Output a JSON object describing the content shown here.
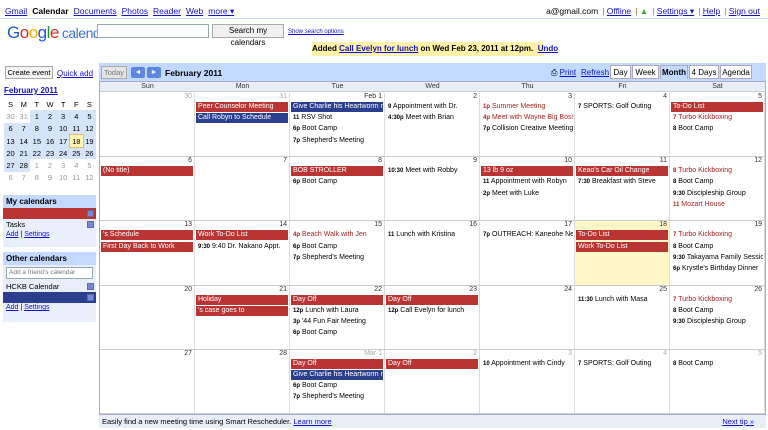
{
  "topbar": {
    "nav": [
      "Gmail",
      "Calendar",
      "Documents",
      "Photos",
      "Reader",
      "Web",
      "more ▾"
    ],
    "account": "a@gmail.com",
    "links": [
      "Offline",
      "Settings ▾",
      "Help",
      "Sign out"
    ]
  },
  "logo": {
    "google": [
      "G",
      "o",
      "o",
      "g",
      "l",
      "e"
    ],
    "product": "calendar"
  },
  "search": {
    "button": "Search my calendars",
    "options": "Show search options"
  },
  "notice": {
    "prefix": "Added ",
    "event": "Call Evelyn for lunch",
    "when": " on Wed Feb 23, 2011 at 12pm.",
    "undo": "Undo"
  },
  "sidebar": {
    "create_label": "Create event",
    "quick_add": "Quick add",
    "mini_title": "February 2011",
    "mini_dow": [
      "S",
      "M",
      "T",
      "W",
      "T",
      "F",
      "S"
    ],
    "mini_weeks": [
      [
        "30",
        "31",
        "1",
        "2",
        "3",
        "4",
        "5"
      ],
      [
        "6",
        "7",
        "8",
        "9",
        "10",
        "11",
        "12"
      ],
      [
        "13",
        "14",
        "15",
        "16",
        "17",
        "18",
        "19"
      ],
      [
        "20",
        "21",
        "22",
        "23",
        "24",
        "25",
        "26"
      ],
      [
        "27",
        "28",
        "1",
        "2",
        "3",
        "4",
        "5"
      ],
      [
        "6",
        "7",
        "8",
        "9",
        "10",
        "11",
        "12"
      ]
    ],
    "my_cal_title": "My calendars",
    "my_cals": [
      "",
      "Tasks"
    ],
    "my_links": [
      "Add",
      "Settings"
    ],
    "other_cal_title": "Other calendars",
    "friend_placeholder": "Add a friend's calendar",
    "other_cals": [
      "HCKB Calendar",
      ""
    ],
    "other_links": [
      "Add",
      "Settings"
    ]
  },
  "toolbar": {
    "today": "Today",
    "prev": "◄",
    "next": "►",
    "title": "February 2011",
    "print": "Print",
    "refresh": "Refresh",
    "views": [
      "Day",
      "Week",
      "Month",
      "4 Days",
      "Agenda"
    ],
    "active_view": "Month"
  },
  "dow": [
    "Sun",
    "Mon",
    "Tue",
    "Wed",
    "Thu",
    "Fri",
    "Sat"
  ],
  "weeks": [
    {
      "days": [
        "30",
        "31",
        "Feb 1",
        "2",
        "3",
        "4",
        "5"
      ],
      "dim": [
        0,
        1
      ],
      "events": [
        {
          "col": 1,
          "row": 0,
          "type": "red",
          "text": "Peer Counselor Meeting"
        },
        {
          "col": 1,
          "row": 1,
          "type": "blue",
          "text": "Call Robyn            to Schedule"
        },
        {
          "col": 2,
          "row": 0,
          "type": "blue",
          "text": "Give Charlie his Heartworm m"
        },
        {
          "col": 2,
          "row": 1,
          "type": "txt",
          "time": "11",
          "text": "RSV Shot"
        },
        {
          "col": 2,
          "row": 2,
          "type": "txt",
          "time": "6p",
          "text": "Boot Camp"
        },
        {
          "col": 2,
          "row": 3,
          "type": "txt",
          "time": "7p",
          "text": "Shepherd's Meeting"
        },
        {
          "col": 3,
          "row": 0,
          "type": "txt",
          "time": "9",
          "text": "Appointment with Dr."
        },
        {
          "col": 3,
          "row": 1,
          "type": "txt",
          "time": "4:30p",
          "text": "Meet with Brian"
        },
        {
          "col": 4,
          "row": 0,
          "type": "txt",
          "rc": 1,
          "time": "1p",
          "text": "Summer Meeting"
        },
        {
          "col": 4,
          "row": 1,
          "type": "txt",
          "rc": 1,
          "time": "4p",
          "text": "Meet with Wayne Big Boss"
        },
        {
          "col": 4,
          "row": 2,
          "type": "txt",
          "time": "7p",
          "text": "Collision Creative Meeting"
        },
        {
          "col": 5,
          "row": 0,
          "type": "txt",
          "time": "7",
          "text": "SPORTS: Golf Outing"
        },
        {
          "col": 6,
          "row": 0,
          "type": "red",
          "text": "To-Do List"
        },
        {
          "col": 6,
          "row": 1,
          "type": "txt",
          "rc": 1,
          "time": "7",
          "text": "Turbo Kickboxing"
        },
        {
          "col": 6,
          "row": 2,
          "type": "txt",
          "time": "8",
          "text": "Boot Camp"
        }
      ]
    },
    {
      "days": [
        "6",
        "7",
        "8",
        "9",
        "10",
        "11",
        "12"
      ],
      "dim": [],
      "events": [
        {
          "col": 0,
          "row": 0,
          "type": "red",
          "text": "(No title)"
        },
        {
          "col": 2,
          "row": 0,
          "type": "red",
          "text": "BOB STROLLER"
        },
        {
          "col": 2,
          "row": 1,
          "type": "txt",
          "time": "6p",
          "text": "Boot Camp"
        },
        {
          "col": 3,
          "row": 0,
          "type": "txt",
          "time": "10:30",
          "text": "Meet with Robby"
        },
        {
          "col": 4,
          "row": 0,
          "type": "red",
          "text": "13 lb 9 oz"
        },
        {
          "col": 4,
          "row": 1,
          "type": "txt",
          "time": "11",
          "text": "Appointment with Robyn"
        },
        {
          "col": 4,
          "row": 2,
          "type": "txt",
          "time": "2p",
          "text": "Meet with Luke"
        },
        {
          "col": 5,
          "row": 0,
          "type": "red",
          "text": "Keao's Car Oil Change"
        },
        {
          "col": 5,
          "row": 1,
          "type": "txt",
          "time": "7:30",
          "text": "Breakfast with Steve"
        },
        {
          "col": 6,
          "row": 0,
          "type": "txt",
          "rc": 1,
          "time": "8",
          "text": "Turbo Kickboxing"
        },
        {
          "col": 6,
          "row": 1,
          "type": "txt",
          "time": "8",
          "text": "Boot Camp"
        },
        {
          "col": 6,
          "row": 2,
          "type": "txt",
          "time": "9:30",
          "text": "Discipleship Group"
        },
        {
          "col": 6,
          "row": 3,
          "type": "txt",
          "rc": 1,
          "time": "11",
          "text": "Mozart House"
        }
      ]
    },
    {
      "days": [
        "13",
        "14",
        "15",
        "16",
        "17",
        "18",
        "19"
      ],
      "dim": [],
      "today": 5,
      "events": [
        {
          "col": 0,
          "row": 0,
          "type": "red",
          "text": "'s Schedule"
        },
        {
          "col": 0,
          "row": 1,
          "type": "red",
          "text": "First Day Back to Work"
        },
        {
          "col": 1,
          "row": 0,
          "type": "red",
          "text": "Work To-Do List"
        },
        {
          "col": 1,
          "row": 1,
          "type": "txt",
          "time": "9:30",
          "text": "9:40 Dr. Nakano Appt."
        },
        {
          "col": 2,
          "row": 0,
          "type": "txt",
          "rc": 1,
          "time": "4p",
          "text": "Beach Walk with Jen"
        },
        {
          "col": 2,
          "row": 1,
          "type": "txt",
          "time": "6p",
          "text": "Boot Camp"
        },
        {
          "col": 2,
          "row": 2,
          "type": "txt",
          "time": "7p",
          "text": "Shepherd's Meeting"
        },
        {
          "col": 3,
          "row": 0,
          "type": "txt",
          "time": "11",
          "text": "Lunch with Kristina"
        },
        {
          "col": 4,
          "row": 0,
          "type": "txt",
          "time": "7p",
          "text": "OUTREACH: Kaneohe Neigh"
        },
        {
          "col": 5,
          "row": 0,
          "type": "red",
          "text": "To-Do List"
        },
        {
          "col": 5,
          "row": 1,
          "type": "red",
          "text": "Work To-Do List"
        },
        {
          "col": 6,
          "row": 0,
          "type": "txt",
          "rc": 1,
          "time": "7",
          "text": "Turbo Kickboxing"
        },
        {
          "col": 6,
          "row": 1,
          "type": "txt",
          "time": "8",
          "text": "Boot Camp"
        },
        {
          "col": 6,
          "row": 2,
          "type": "txt",
          "time": "9:30",
          "text": "Takayama Family Session"
        },
        {
          "col": 6,
          "row": 3,
          "type": "txt",
          "time": "6p",
          "text": "Krystle's Birthday Dinner"
        }
      ]
    },
    {
      "days": [
        "20",
        "21",
        "22",
        "23",
        "24",
        "25",
        "26"
      ],
      "dim": [],
      "events": [
        {
          "col": 1,
          "row": 0,
          "type": "red",
          "text": "Holiday"
        },
        {
          "col": 1,
          "row": 1,
          "type": "red",
          "text": "                  's case goes to"
        },
        {
          "col": 2,
          "row": 0,
          "type": "red",
          "text": "Day Off"
        },
        {
          "col": 2,
          "row": 1,
          "type": "txt",
          "time": "12p",
          "text": "Lunch with Laura"
        },
        {
          "col": 2,
          "row": 2,
          "type": "txt",
          "time": "3p",
          "text": "'44 Fun Fair Meeting"
        },
        {
          "col": 2,
          "row": 3,
          "type": "txt",
          "time": "6p",
          "text": "Boot Camp"
        },
        {
          "col": 3,
          "row": 0,
          "type": "red",
          "text": "Day Off"
        },
        {
          "col": 3,
          "row": 1,
          "type": "txt",
          "time": "12p",
          "text": "Call Evelyn for lunch"
        },
        {
          "col": 5,
          "row": 0,
          "type": "txt",
          "time": "11:30",
          "text": "Lunch with Masa"
        },
        {
          "col": 6,
          "row": 0,
          "type": "txt",
          "rc": 1,
          "time": "7",
          "text": "Turbo Kickboxing"
        },
        {
          "col": 6,
          "row": 1,
          "type": "txt",
          "time": "8",
          "text": "Boot Camp"
        },
        {
          "col": 6,
          "row": 2,
          "type": "txt",
          "time": "9:30",
          "text": "Discipleship Group"
        }
      ]
    },
    {
      "days": [
        "27",
        "28",
        "Mar 1",
        "2",
        "3",
        "4",
        "5"
      ],
      "dim": [
        2,
        3,
        4,
        5,
        6
      ],
      "events": [
        {
          "col": 2,
          "row": 0,
          "type": "red",
          "text": "Day Off"
        },
        {
          "col": 2,
          "row": 1,
          "type": "blue",
          "text": "Give Charlie his Heartworm m"
        },
        {
          "col": 2,
          "row": 2,
          "type": "txt",
          "time": "6p",
          "text": "Boot Camp"
        },
        {
          "col": 2,
          "row": 3,
          "type": "txt",
          "time": "7p",
          "text": "Shepherd's Meeting"
        },
        {
          "col": 3,
          "row": 0,
          "type": "red",
          "text": "Day Off"
        },
        {
          "col": 4,
          "row": 0,
          "type": "txt",
          "time": "10",
          "text": "Appointment with Cindy"
        },
        {
          "col": 5,
          "row": 0,
          "type": "txt",
          "time": "7",
          "text": "SPORTS: Golf Outing"
        },
        {
          "col": 6,
          "row": 0,
          "type": "txt",
          "time": "8",
          "text": "Boot Camp"
        }
      ]
    }
  ],
  "footer": {
    "text": "Easily find a new meeting time using Smart Rescheduler.",
    "link": "Learn more",
    "next": "Next tip »"
  }
}
